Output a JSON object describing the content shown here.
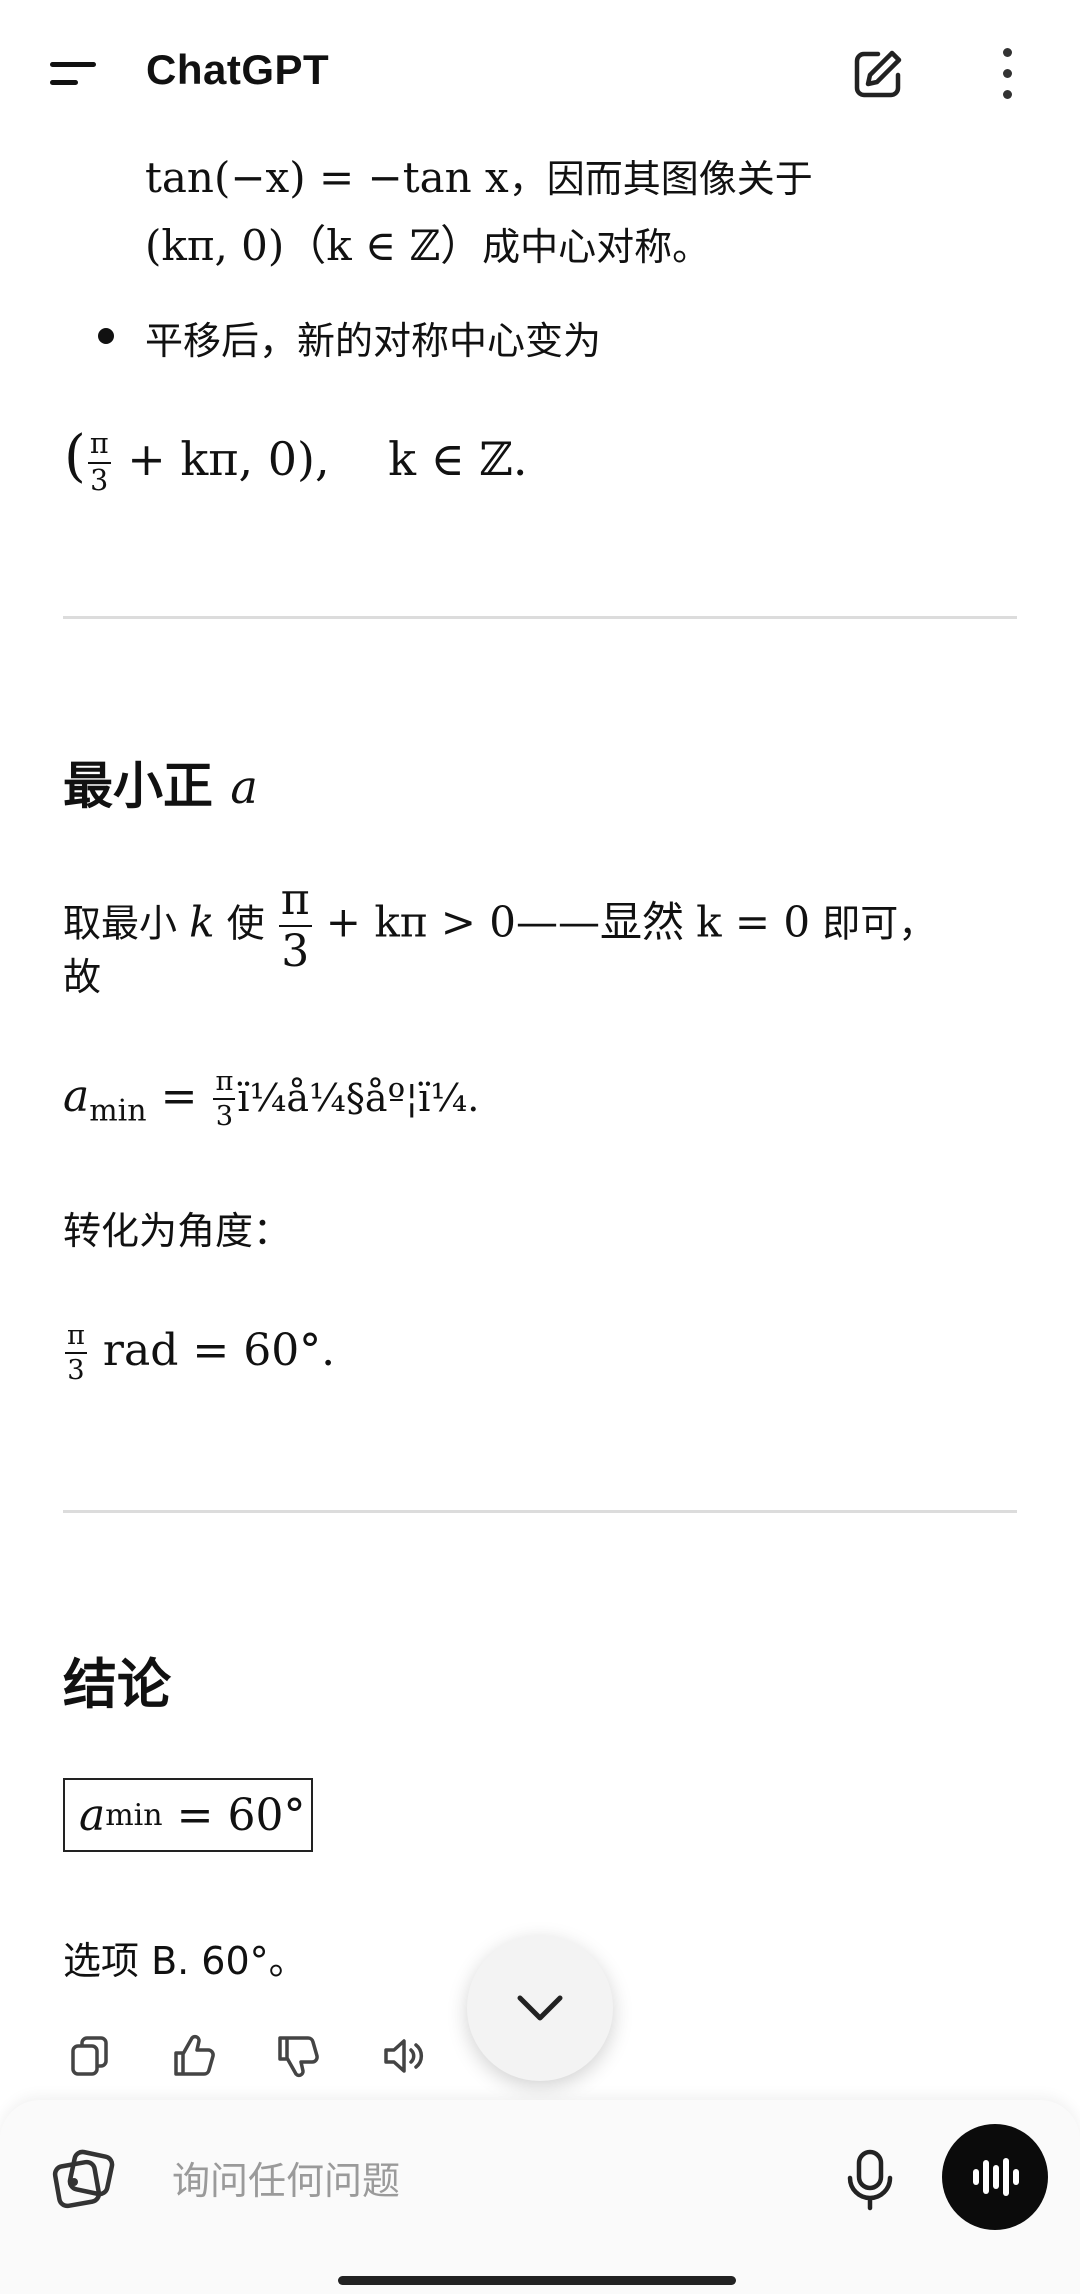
{
  "header": {
    "title": "ChatGPT",
    "icons": [
      "menu-icon",
      "edit-icon",
      "more-options-icon"
    ]
  },
  "content": {
    "line1": {
      "tan_lhs": "tan(−x) = −tan x",
      "tan_rest": "，因而其图像关于"
    },
    "line2": {
      "point": "(kπ, 0)",
      "cond": "（k ∈ ℤ）",
      "rest": "成中心对称。"
    },
    "bullet_text": "平移后，新的对称中心变为",
    "formula1": {
      "open": "(",
      "frac_num": "π",
      "frac_den": "3",
      "rest": "+ kπ, 0)",
      "tail": ",    k ∈ ℤ."
    },
    "section_min": {
      "heading": "最小正",
      "var": "a"
    },
    "para1": {
      "a": "取最小",
      "k": "k",
      "b": "使",
      "frac_num": "π",
      "frac_den": "3",
      "c": "+ kπ > 0——显然",
      "d": "k = 0",
      "e": "即可，",
      "f": "故"
    },
    "formula2": {
      "lhs": "a",
      "sub": "min",
      "eq": "=",
      "frac_num": "π",
      "frac_den": "3",
      "garbled": "ï¼å¼§åº¦ï¼."
    },
    "para2": "转化为角度：",
    "formula3": {
      "frac_num": "π",
      "frac_den": "3",
      "rest": "rad = 60°."
    },
    "section_conclusion": {
      "heading": "结论"
    },
    "boxed": {
      "lhs": "a",
      "sub": "min",
      "rhs": "= 60°"
    },
    "answer": "选项 B. 60°。"
  },
  "actions": [
    "copy-icon",
    "thumbs-up-icon",
    "thumbs-down-icon",
    "read-aloud-icon"
  ],
  "scroll_button_icon": "chevron-down-icon",
  "composer": {
    "placeholder": "询问任何问题",
    "icons": [
      "image-attach-icon",
      "microphone-icon",
      "voice-mode-icon"
    ]
  }
}
